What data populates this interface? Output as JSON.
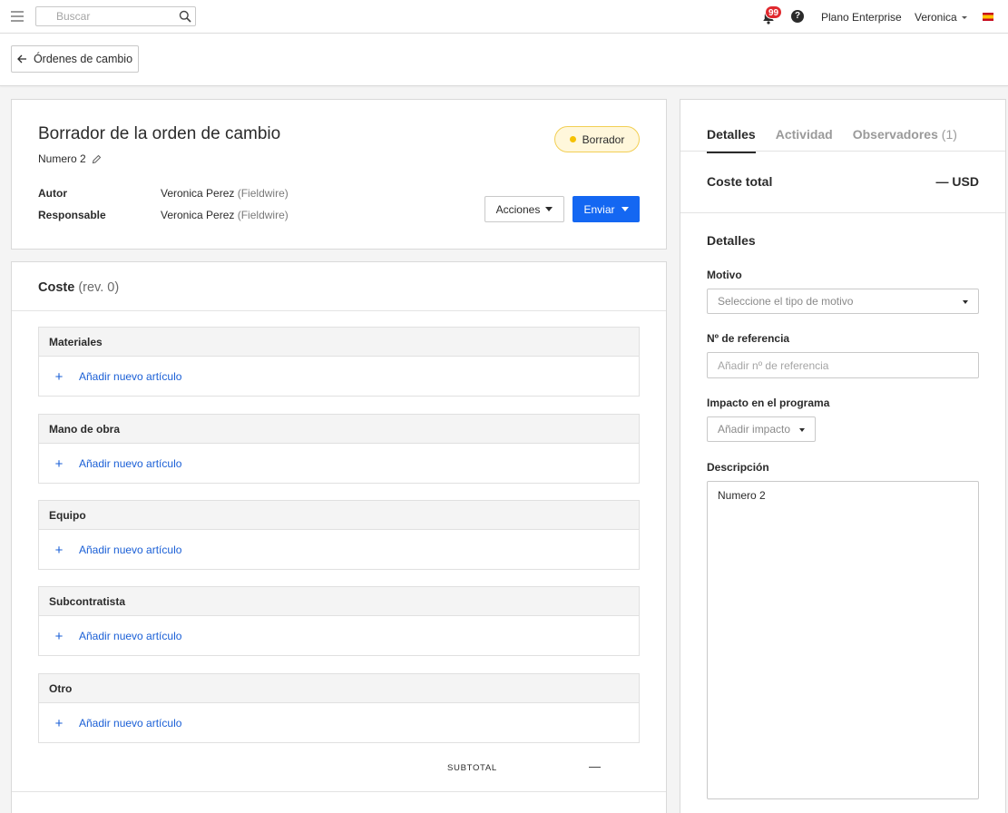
{
  "topbar": {
    "search_placeholder": "Buscar",
    "notifications_count": "99",
    "help_symbol": "?",
    "plan_label": "Plano Enterprise",
    "user_name": "Veronica",
    "flag": "spain-flag-icon"
  },
  "header": {
    "back_label": "Órdenes de cambio"
  },
  "order": {
    "title": "Borrador de la orden de cambio",
    "number": "Numero 2",
    "status": "Borrador",
    "status_color": "#f5c100",
    "author_label": "Autor",
    "author_name": "Veronica Perez",
    "author_company": "(Fieldwire)",
    "assignee_label": "Responsable",
    "assignee_name": "Veronica Perez",
    "assignee_company": "(Fieldwire)",
    "actions_label": "Acciones",
    "send_label": "Enviar"
  },
  "cost": {
    "title": "Coste",
    "revision": "(rev. 0)",
    "add_label": "Añadir nuevo artículo",
    "groups": [
      "Materiales",
      "Mano de obra",
      "Equipo",
      "Subcontratista",
      "Otro"
    ],
    "subtotal_label": "SUBTOTAL",
    "subtotal_value": "—"
  },
  "panel": {
    "tabs": [
      {
        "label": "Detalles",
        "active": true
      },
      {
        "label": "Actividad",
        "active": false
      },
      {
        "label": "Observadores",
        "count": "(1)",
        "active": false
      }
    ],
    "total_label": "Coste total",
    "total_value": "— USD",
    "details_title": "Detalles",
    "reason_label": "Motivo",
    "reason_placeholder": "Seleccione el tipo de motivo",
    "ref_label": "Nº de referencia",
    "ref_placeholder": "Añadir nº de referencia",
    "impact_label": "Impacto en el programa",
    "impact_placeholder": "Añadir impacto",
    "description_label": "Descripción",
    "description_value": "Numero 2"
  },
  "colors": {
    "accent": "#1467f2",
    "link": "#1a5fd6",
    "badge": "#e0282e",
    "status_bg": "#fff7db"
  }
}
